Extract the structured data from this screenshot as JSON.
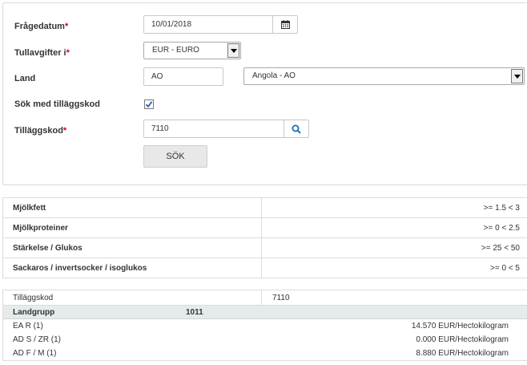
{
  "form": {
    "query_date": {
      "label": "Frågedatum",
      "required_mark": "*",
      "value": "10/01/2018",
      "icon": "calendar-icon"
    },
    "currency": {
      "label": "Tullavgifter i",
      "required_mark": "*",
      "selected": "EUR - EURO"
    },
    "country": {
      "label": "Land",
      "code_value": "AO",
      "selected": "Angola - AO"
    },
    "additional_code_toggle": {
      "label": "Sök med tilläggskod",
      "checked": true
    },
    "additional_code": {
      "label": "Tilläggskod",
      "required_mark": "*",
      "value": "7110",
      "icon": "search-icon"
    },
    "search_button": "SÖK"
  },
  "attributes": [
    {
      "name": "Mjölkfett",
      "value": ">= 1.5 < 3"
    },
    {
      "name": "Mjölkproteiner",
      "value": ">= 0 < 2.5"
    },
    {
      "name": "Stärkelse / Glukos",
      "value": ">= 25 < 50"
    },
    {
      "name": "Sackaros / invertsocker / isoglukos",
      "value": ">= 0 < 5"
    }
  ],
  "result": {
    "code_label": "Tilläggskod",
    "code_value": "7110",
    "group_label": "Landgrupp",
    "group_value": "1011",
    "rows": [
      {
        "name": "EA R (1)",
        "value": "14.570 EUR/Hectokilogram"
      },
      {
        "name": "AD S / ZR (1)",
        "value": "0.000 EUR/Hectokilogram"
      },
      {
        "name": "AD F / M (1)",
        "value": "8.880 EUR/Hectokilogram"
      }
    ]
  },
  "colors": {
    "required": "#d0021b",
    "group_row_bg": "#e5ebeb",
    "search_icon": "#1a6fb5"
  }
}
